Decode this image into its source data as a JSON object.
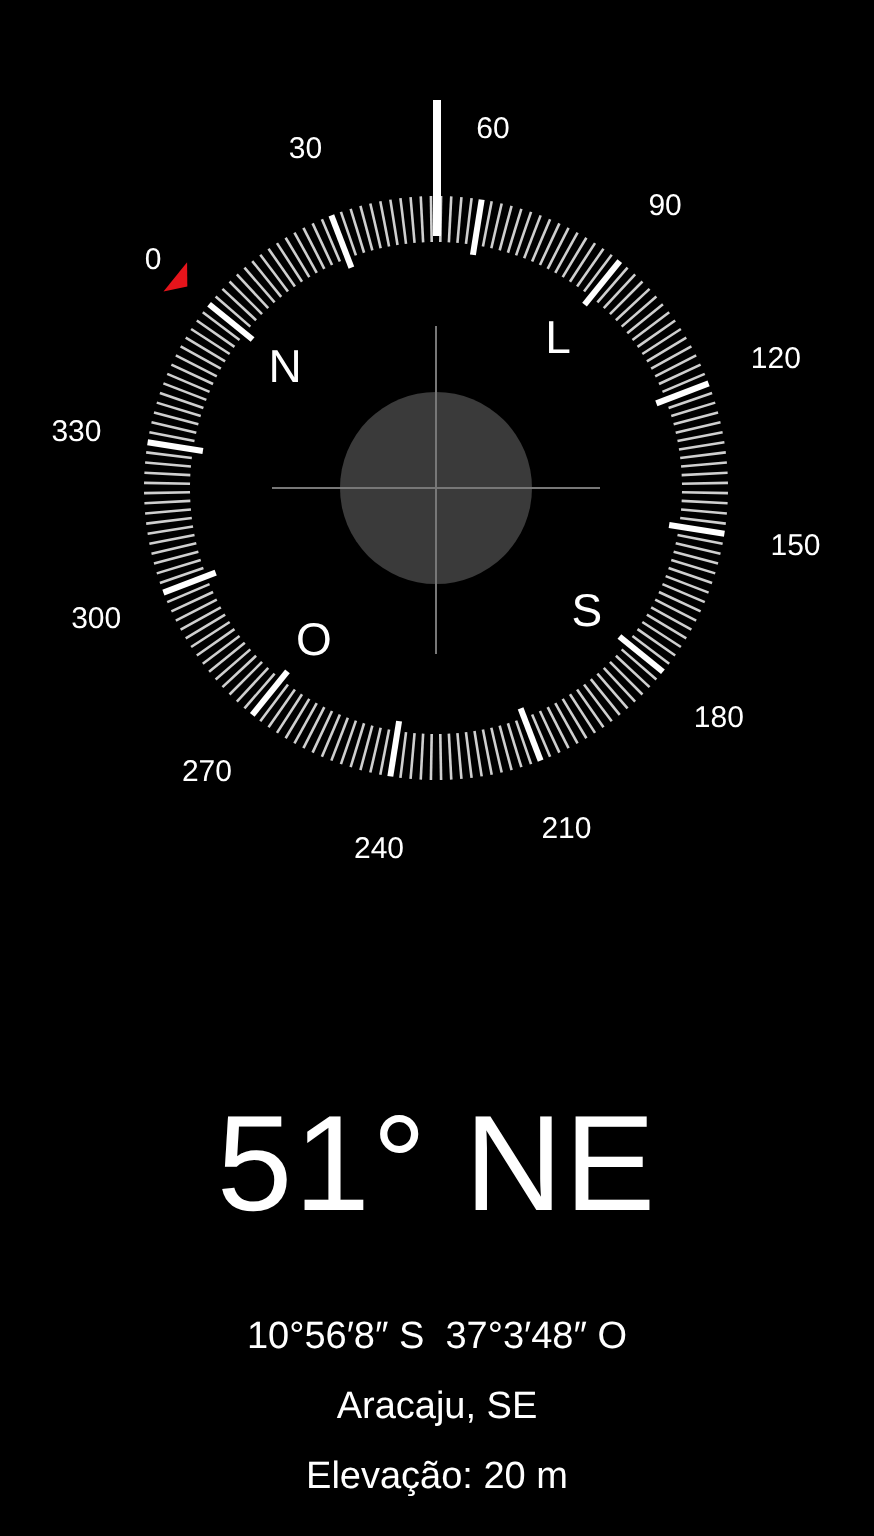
{
  "compass": {
    "degree_labels": [
      "0",
      "30",
      "60",
      "90",
      "120",
      "150",
      "180",
      "210",
      "240",
      "270",
      "300",
      "330"
    ],
    "cardinal_labels": [
      "N",
      "L",
      "S",
      "O"
    ]
  },
  "readout": {
    "heading": "51°",
    "direction": "NE",
    "coordinates": "10°56′8″ S  37°3′48″ O",
    "location": "Aracaju, SE",
    "elevation": "Elevação: 20 m"
  }
}
